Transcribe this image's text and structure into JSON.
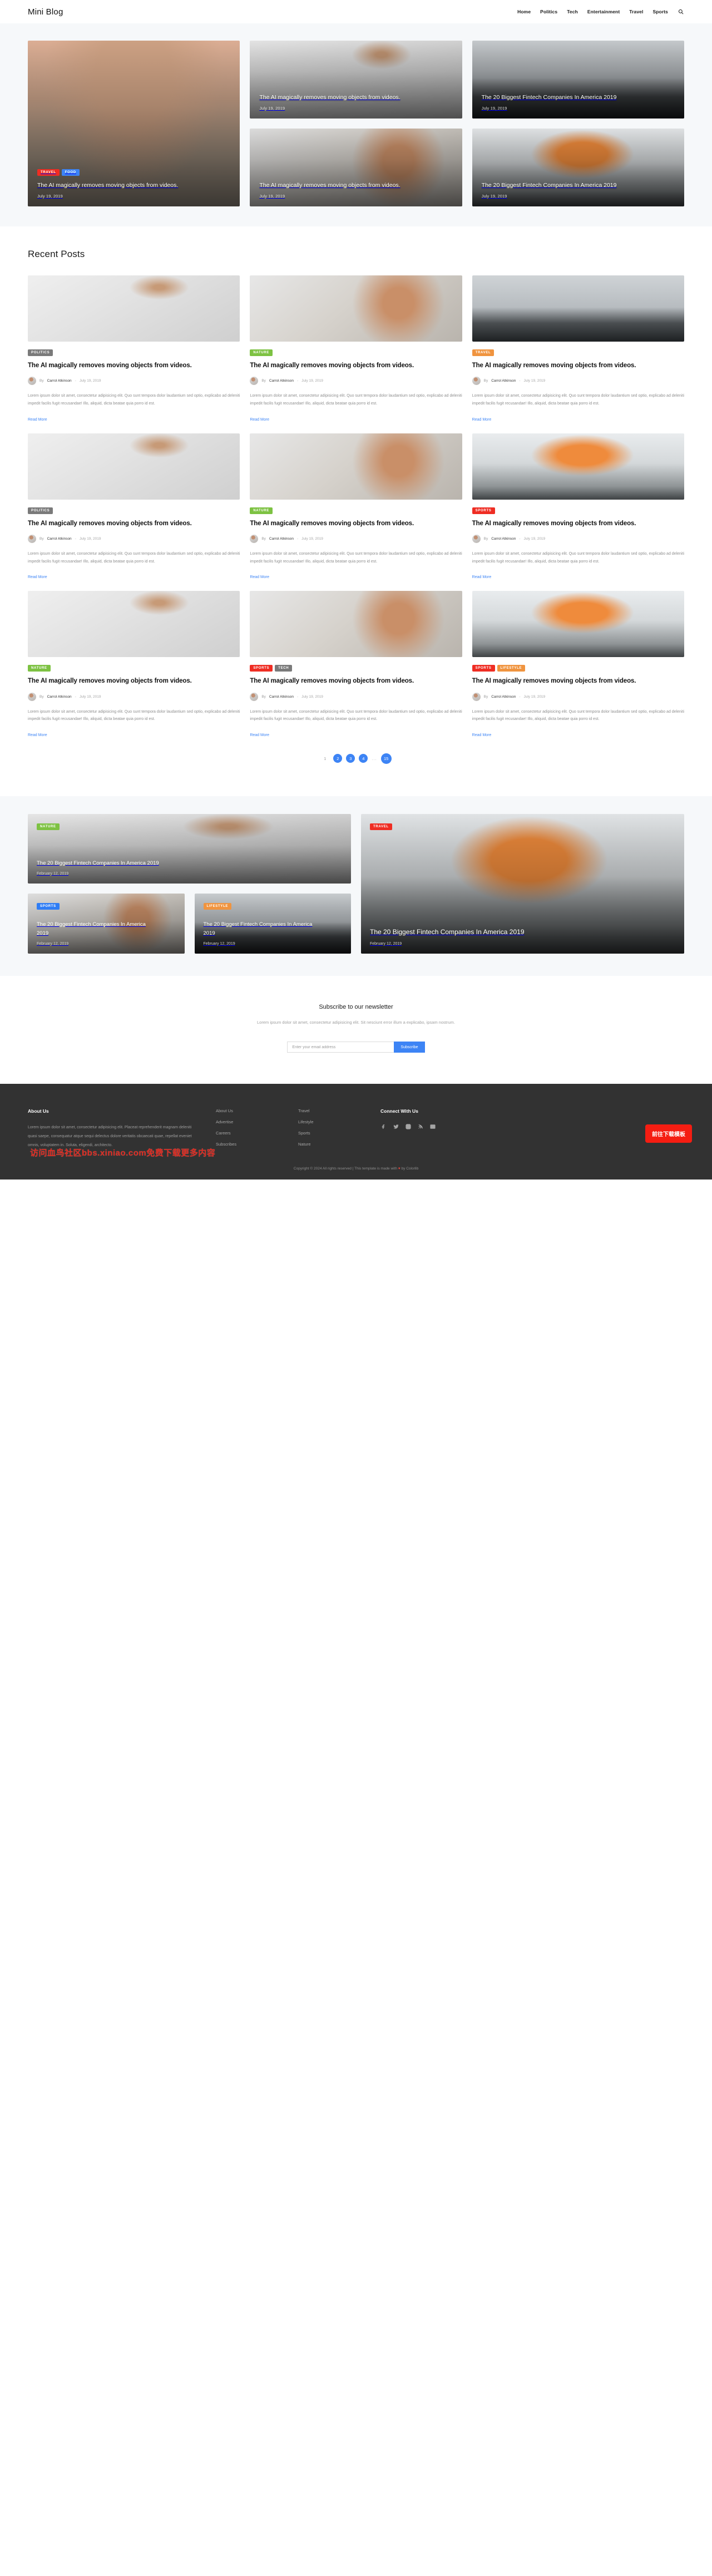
{
  "header": {
    "brand": "Mini Blog",
    "nav": [
      {
        "label": "Home"
      },
      {
        "label": "Politics"
      },
      {
        "label": "Tech"
      },
      {
        "label": "Entertainment"
      },
      {
        "label": "Travel"
      },
      {
        "label": "Sports"
      }
    ],
    "search_icon": "search-icon"
  },
  "colors": {
    "accent_blue": "#3d84f5",
    "tag_politics": "#7a7a7a",
    "tag_nature": "#7dc242",
    "tag_travel_orange": "#f0943f",
    "tag_travel_red": "#ef2d23",
    "tag_food": "#3d84f5",
    "tag_sports": "#ef2d23",
    "tag_tech": "#7a7a7a",
    "tag_lifestyle": "#f0943f",
    "tag_sports_blue": "#2f7df5",
    "footer_bg": "#323232",
    "hero_bg": "#f6f8fa"
  },
  "hero": {
    "cards": [
      {
        "id": "hero-top-left",
        "title": "The AI magically removes moving objects from videos.",
        "date": "July 19, 2019",
        "tags": [],
        "image": "img-desk"
      },
      {
        "id": "hero-center",
        "title": "The AI magically removes moving objects from videos.",
        "date": "July 19, 2019",
        "tags": [
          {
            "label": "TRAVEL",
            "color": "#ef2d23"
          },
          {
            "label": "FOOD",
            "color": "#3d84f5"
          }
        ],
        "image": "img-dog"
      },
      {
        "id": "hero-top-right",
        "title": "The 20 Biggest Fintech Companies In America 2019",
        "date": "July 19, 2019",
        "tags": [],
        "image": "img-mountain"
      },
      {
        "id": "hero-bottom-left",
        "title": "The AI magically removes moving objects from videos.",
        "date": "July 19, 2019",
        "tags": [],
        "image": "img-desk2"
      },
      {
        "id": "hero-bottom-right",
        "title": "The 20 Biggest Fintech Companies In America 2019",
        "date": "July 19, 2019",
        "tags": [],
        "image": "img-book"
      }
    ]
  },
  "recent": {
    "title": "Recent Posts",
    "read_more_label": "Read More",
    "by_label": "By",
    "separator": "-",
    "excerpt": "Lorem ipsum dolor sit amet, consectetur adipisicing elit. Quo sunt tempora dolor laudantium sed optio, explicabo ad deleniti impedit facilis fugit recusandae! Illo, aliquid, dicta beatae quia porro id est.",
    "posts": [
      {
        "tags": [
          {
            "label": "POLITICS",
            "color": "#7a7a7a"
          }
        ],
        "title": "The AI magically removes moving objects from videos.",
        "author": "Carrol Atkinson",
        "date": "July 19, 2019",
        "image": "img-desk"
      },
      {
        "tags": [
          {
            "label": "NATURE",
            "color": "#7dc242"
          }
        ],
        "title": "The AI magically removes moving objects from videos.",
        "author": "Carrol Atkinson",
        "date": "July 19, 2019",
        "image": "img-desk2"
      },
      {
        "tags": [
          {
            "label": "TRAVEL",
            "color": "#f0943f"
          }
        ],
        "title": "The AI magically removes moving objects from videos.",
        "author": "Carrol Atkinson",
        "date": "July 19, 2019",
        "image": "img-mountain"
      },
      {
        "tags": [
          {
            "label": "POLITICS",
            "color": "#7a7a7a"
          }
        ],
        "title": "The AI magically removes moving objects from videos.",
        "author": "Carrol Atkinson",
        "date": "July 19, 2019",
        "image": "img-desk"
      },
      {
        "tags": [
          {
            "label": "NATURE",
            "color": "#7dc242"
          }
        ],
        "title": "The AI magically removes moving objects from videos.",
        "author": "Carrol Atkinson",
        "date": "July 19, 2019",
        "image": "img-desk2"
      },
      {
        "tags": [
          {
            "label": "SPORTS",
            "color": "#ef2d23"
          }
        ],
        "title": "The AI magically removes moving objects from videos.",
        "author": "Carrol Atkinson",
        "date": "July 19, 2019",
        "image": "img-book"
      },
      {
        "tags": [
          {
            "label": "NATURE",
            "color": "#7dc242"
          }
        ],
        "title": "The AI magically removes moving objects from videos.",
        "author": "Carrol Atkinson",
        "date": "July 19, 2019",
        "image": "img-desk"
      },
      {
        "tags": [
          {
            "label": "SPORTS",
            "color": "#ef2d23"
          },
          {
            "label": "TECH",
            "color": "#7a7a7a"
          }
        ],
        "title": "The AI magically removes moving objects from videos.",
        "author": "Carrol Atkinson",
        "date": "July 19, 2019",
        "image": "img-desk2"
      },
      {
        "tags": [
          {
            "label": "SPORTS",
            "color": "#ef2d23"
          },
          {
            "label": "LIFESTYLE",
            "color": "#f0943f"
          }
        ],
        "title": "The AI magically removes moving objects from videos.",
        "author": "Carrol Atkinson",
        "date": "July 19, 2019",
        "image": "img-book"
      }
    ]
  },
  "pagination": {
    "items": [
      {
        "label": "1",
        "current": true
      },
      {
        "label": "2",
        "current": false
      },
      {
        "label": "3",
        "current": false
      },
      {
        "label": "4",
        "current": false
      }
    ],
    "dots": "...",
    "last": "15"
  },
  "featured": {
    "cards": [
      {
        "id": "featured-big",
        "tags": [
          {
            "label": "NATURE",
            "color": "#7dc242"
          }
        ],
        "title": "The 20 Biggest Fintech Companies In America 2019",
        "date": "February 12, 2019",
        "image": "img-desk"
      },
      {
        "id": "featured-small-1",
        "tags": [
          {
            "label": "SPORTS",
            "color": "#2f7df5"
          }
        ],
        "title": "The 20 Biggest Fintech Companies In America 2019",
        "date": "February 12, 2019",
        "image": "img-desk2"
      },
      {
        "id": "featured-small-2",
        "tags": [
          {
            "label": "LIFESTYLE",
            "color": "#f0943f"
          }
        ],
        "title": "The 20 Biggest Fintech Companies In America 2019",
        "date": "February 12, 2019",
        "image": "img-mountain"
      },
      {
        "id": "featured-tall",
        "tags": [
          {
            "label": "TRAVEL",
            "color": "#ef2d23"
          }
        ],
        "title": "The 20 Biggest Fintech Companies In America 2019",
        "date": "February 12, 2019",
        "image": "img-book"
      }
    ]
  },
  "newsletter": {
    "title": "Subscribe to our newsletter",
    "subtitle": "Lorem ipsum dolor sit amet, consectetur adipisicing elit. Sit nesciunt error illum a explicabo, ipsam nostrum.",
    "placeholder": "Enter your email address",
    "button": "Subscribe"
  },
  "footer": {
    "about_head": "About Us",
    "about_text": "Lorem ipsum dolor sit amet, consectetur adipisicing elit. Placeat reprehenderit magnam deleniti quasi saepe, consequatur atque sequi delectus dolore veritatis obcaecati quae, repellat eveniet omnis, voluptatem in. Soluta, eligendi, architecto.",
    "links_col1": [
      "About Us",
      "Advertise",
      "Careers",
      "Subscribes"
    ],
    "links_col2": [
      "Travel",
      "Lifestyle",
      "Sports",
      "Nature"
    ],
    "connect_head": "Connect With Us",
    "social": [
      "facebook-icon",
      "twitter-icon",
      "instagram-icon",
      "rss-icon",
      "email-icon"
    ],
    "copyright_pre": "Copyright © 2024 All rights reserved | This template is made with ",
    "copyright_heart": "♥",
    "copyright_post": " by Colorlib"
  },
  "overlay": {
    "watermark": "访问血鸟社区bbs.xiniao.com免费下载更多内容",
    "download_button": "前往下载模板"
  }
}
